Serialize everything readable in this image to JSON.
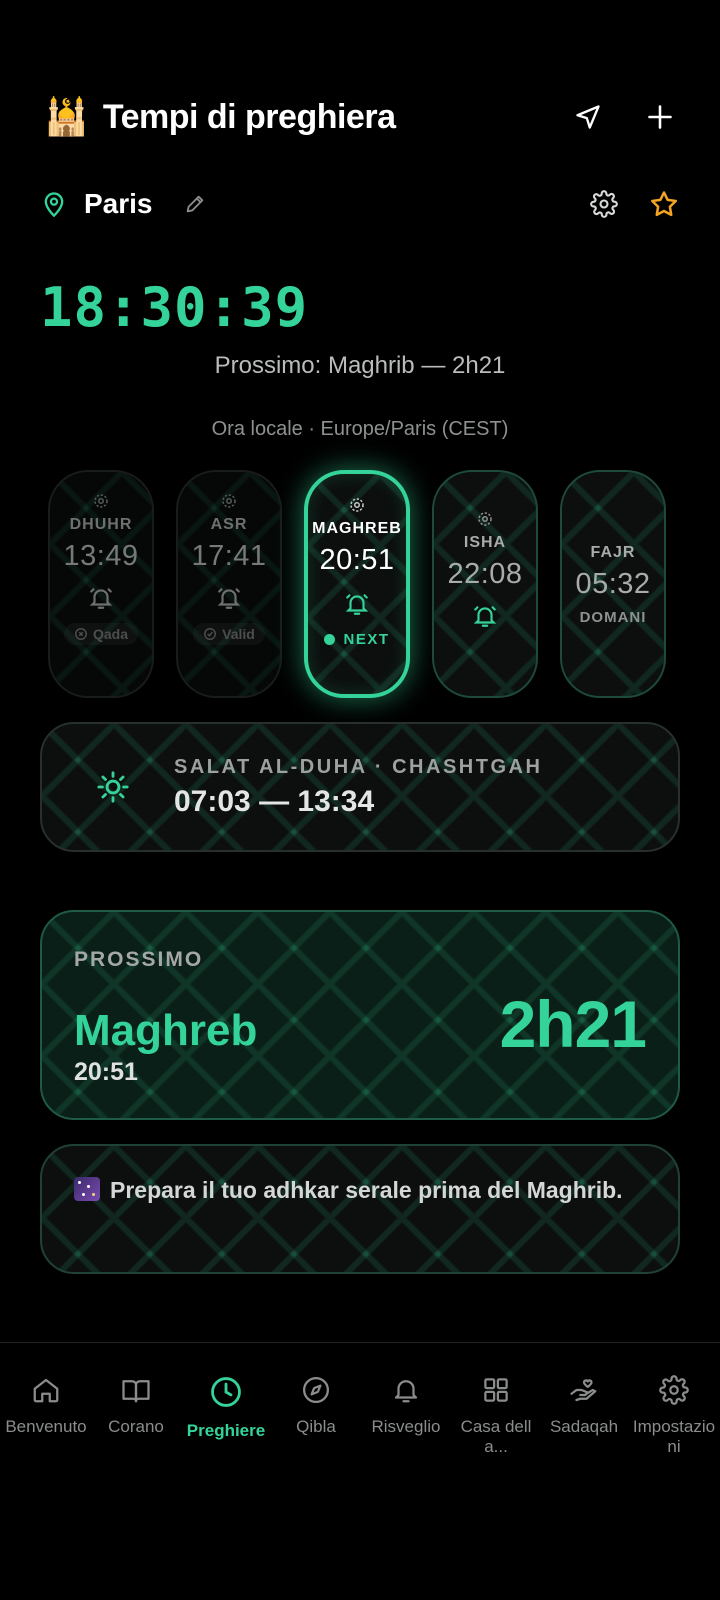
{
  "header": {
    "logo_emoji": "🕌",
    "title": "Tempi di preghiera",
    "icons": [
      "navigation-arrow-icon",
      "plus-icon"
    ]
  },
  "location": {
    "city": "Paris",
    "icons": [
      "map-pin-icon",
      "pencil-icon",
      "gear-icon",
      "star-icon"
    ]
  },
  "clock": {
    "time": "18:30:39",
    "next_line": "Prossimo: Maghrib — 2h21",
    "timezone_line": "Ora locale · Europe/Paris (CEST)"
  },
  "prayers": [
    {
      "name": "DHUHR",
      "time": "13:49",
      "status": "Qada",
      "state": "past"
    },
    {
      "name": "ASR",
      "time": "17:41",
      "status": "Valid",
      "state": "past"
    },
    {
      "name": "MAGHREB",
      "time": "20:51",
      "status": "NEXT",
      "state": "active"
    },
    {
      "name": "ISHA",
      "time": "22:08",
      "status": "",
      "state": "future"
    },
    {
      "name": "FAJR",
      "time": "05:32",
      "status": "DOMANI",
      "state": "tomorrow"
    }
  ],
  "duha": {
    "label": "SALAT AL-DUHA · CHASHTGAH",
    "range": "07:03 — 13:34"
  },
  "next_prayer": {
    "label": "PROSSIMO",
    "name": "Maghreb",
    "time": "20:51",
    "countdown": "2h21"
  },
  "tip": {
    "text": "Prepara il tuo adhkar serale prima del Maghrib."
  },
  "nav": {
    "items": [
      {
        "label": "Benvenuto",
        "icon": "home-icon"
      },
      {
        "label": "Corano",
        "icon": "book-icon"
      },
      {
        "label": "Preghiere",
        "icon": "clock-icon",
        "active": true
      },
      {
        "label": "Qibla",
        "icon": "compass-icon"
      },
      {
        "label": "Risveglio",
        "icon": "bell-icon"
      },
      {
        "label": "Casa della...",
        "icon": "grid-icon"
      },
      {
        "label": "Sadaqah",
        "icon": "hand-heart-icon"
      },
      {
        "label": "Impostazioni",
        "icon": "gear-icon"
      }
    ]
  },
  "colors": {
    "accent": "#34d399",
    "star": "#f5a524",
    "background": "#000000"
  }
}
